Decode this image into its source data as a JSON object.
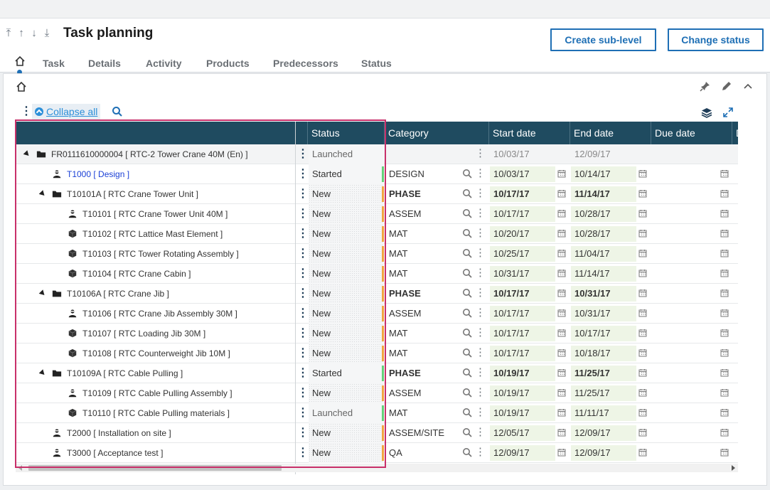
{
  "header": {
    "title": "Task planning",
    "nav_icons": [
      "first-arrow-icon",
      "up-arrow-icon",
      "down-arrow-icon",
      "last-arrow-icon"
    ],
    "create_sublevel": "Create sub-level",
    "change_status": "Change status",
    "tabs": [
      "Task",
      "Details",
      "Activity",
      "Products",
      "Predecessors",
      "Status"
    ]
  },
  "toolbar": {
    "collapse_all": "Collapse all"
  },
  "grid": {
    "columns": {
      "status": "Status",
      "category": "Category",
      "start": "Start date",
      "end": "End date",
      "due": "Due date",
      "cut": "D"
    },
    "rows": [
      {
        "label": "FR0111610000004 [ RTC-2 Tower Crane 40M (En) ]",
        "level": 0,
        "icon": "folder-icon",
        "toggle": true,
        "status": "Launched",
        "statusColor": "",
        "category": "",
        "start": "10/03/17",
        "end": "12/09/17",
        "style": "root"
      },
      {
        "label": "T1000 [ Design ]",
        "level": 1,
        "icon": "person-icon",
        "toggle": false,
        "status": "Started",
        "statusColor": "#66d17a",
        "category": "DESIGN",
        "start": "10/03/17",
        "end": "10/14/17",
        "style": "link"
      },
      {
        "label": "T10101A [ RTC Crane Tower Unit ]",
        "level": 1,
        "icon": "folder-icon",
        "toggle": true,
        "status": "New",
        "statusColor": "#f0a640",
        "category": "PHASE",
        "start": "10/17/17",
        "end": "11/14/17",
        "style": "phase"
      },
      {
        "label": "T10101 [ RTC Crane Tower Unit 40M ]",
        "level": 2,
        "icon": "person-icon",
        "toggle": false,
        "status": "New",
        "statusColor": "#f0a640",
        "category": "ASSEM",
        "start": "10/17/17",
        "end": "10/28/17",
        "style": "normal"
      },
      {
        "label": "T10102 [ RTC Lattice Mast Element ]",
        "level": 2,
        "icon": "box-icon",
        "toggle": false,
        "status": "New",
        "statusColor": "#f0a640",
        "category": "MAT",
        "start": "10/20/17",
        "end": "10/28/17",
        "style": "normal"
      },
      {
        "label": "T10103 [ RTC Tower Rotating Assembly ]",
        "level": 2,
        "icon": "box-icon",
        "toggle": false,
        "status": "New",
        "statusColor": "#f0a640",
        "category": "MAT",
        "start": "10/25/17",
        "end": "11/04/17",
        "style": "normal"
      },
      {
        "label": "T10104 [ RTC Crane Cabin ]",
        "level": 2,
        "icon": "box-icon",
        "toggle": false,
        "status": "New",
        "statusColor": "#f0a640",
        "category": "MAT",
        "start": "10/31/17",
        "end": "11/14/17",
        "style": "normal"
      },
      {
        "label": "T10106A [ RTC Crane Jib ]",
        "level": 1,
        "icon": "folder-icon",
        "toggle": true,
        "status": "New",
        "statusColor": "#f0a640",
        "category": "PHASE",
        "start": "10/17/17",
        "end": "10/31/17",
        "style": "phase"
      },
      {
        "label": "T10106 [ RTC Crane Jib Assembly 30M ]",
        "level": 2,
        "icon": "person-icon",
        "toggle": false,
        "status": "New",
        "statusColor": "#f0a640",
        "category": "ASSEM",
        "start": "10/17/17",
        "end": "10/31/17",
        "style": "normal"
      },
      {
        "label": "T10107 [ RTC Loading Jib 30M ]",
        "level": 2,
        "icon": "box-icon",
        "toggle": false,
        "status": "New",
        "statusColor": "#f0a640",
        "category": "MAT",
        "start": "10/17/17",
        "end": "10/17/17",
        "style": "normal"
      },
      {
        "label": "T10108 [ RTC Counterweight Jib 10M ]",
        "level": 2,
        "icon": "box-icon",
        "toggle": false,
        "status": "New",
        "statusColor": "#f0a640",
        "category": "MAT",
        "start": "10/17/17",
        "end": "10/18/17",
        "style": "normal"
      },
      {
        "label": "T10109A [ RTC Cable Pulling ]",
        "level": 1,
        "icon": "folder-icon",
        "toggle": true,
        "status": "Started",
        "statusColor": "#66d17a",
        "category": "PHASE",
        "start": "10/19/17",
        "end": "11/25/17",
        "style": "phase"
      },
      {
        "label": "T10109 [ RTC Cable Pulling Assembly ]",
        "level": 2,
        "icon": "person-icon",
        "toggle": false,
        "status": "New",
        "statusColor": "#f0a640",
        "category": "ASSEM",
        "start": "10/19/17",
        "end": "11/25/17",
        "style": "normal"
      },
      {
        "label": "T10110 [ RTC Cable Pulling materials ]",
        "level": 2,
        "icon": "box-icon",
        "toggle": false,
        "status": "Launched",
        "statusColor": "#66d17a",
        "category": "MAT",
        "start": "10/19/17",
        "end": "11/11/17",
        "style": "normal"
      },
      {
        "label": "T2000 [ Installation on site ]",
        "level": 1,
        "icon": "person-icon",
        "toggle": false,
        "status": "New",
        "statusColor": "#f0a640",
        "category": "ASSEM/SITE",
        "start": "12/05/17",
        "end": "12/09/17",
        "style": "normal"
      },
      {
        "label": "T3000 [ Acceptance test ]",
        "level": 1,
        "icon": "person-icon",
        "toggle": false,
        "status": "New",
        "statusColor": "#f0a640",
        "category": "QA",
        "start": "12/09/17",
        "end": "12/09/17",
        "style": "normal"
      }
    ]
  }
}
